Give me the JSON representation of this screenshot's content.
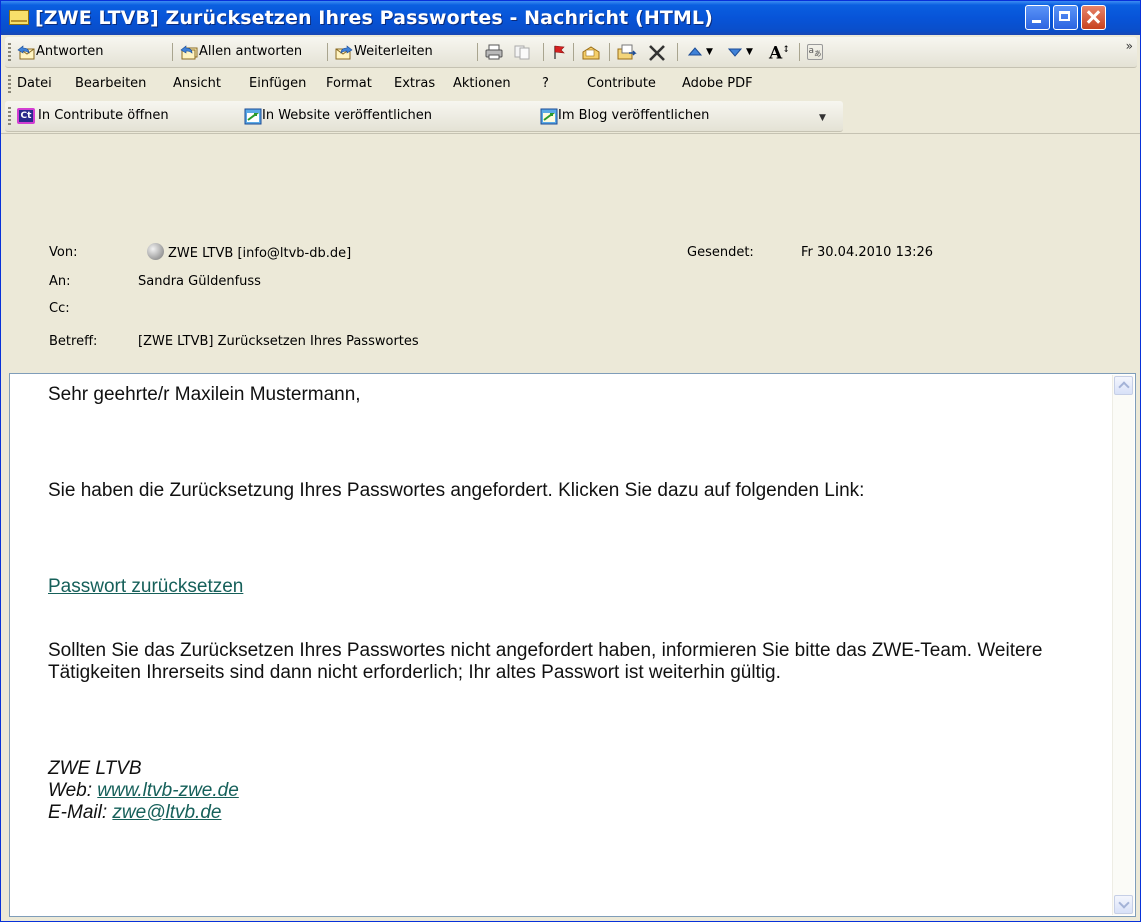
{
  "window": {
    "title": "[ZWE LTVB] Zurücksetzen Ihres Passwortes - Nachricht (HTML)"
  },
  "toolbar": {
    "reply": "Antworten",
    "reply_all": "Allen antworten",
    "forward": "Weiterleiten",
    "overflow": "»"
  },
  "menu": {
    "items": [
      "Datei",
      "Bearbeiten",
      "Ansicht",
      "Einfügen",
      "Format",
      "Extras",
      "Aktionen",
      "?",
      "Contribute",
      "Adobe PDF"
    ]
  },
  "contribute_toolbar": {
    "open_in_contribute": "In Contribute öffnen",
    "publish_website": "In Website veröffentlichen",
    "publish_blog": "Im Blog veröffentlichen",
    "ct_badge": "Ct"
  },
  "header": {
    "from_label": "Von:",
    "from_value": "ZWE LTVB [info@ltvb-db.de]",
    "sent_label": "Gesendet:",
    "sent_value": "Fr 30.04.2010 13:26",
    "to_label": "An:",
    "to_value": "Sandra Güldenfuss",
    "cc_label": "Cc:",
    "cc_value": "",
    "subject_label": "Betreff:",
    "subject_value": "[ZWE LTVB] Zurücksetzen Ihres Passwortes"
  },
  "message": {
    "greeting": "Sehr geehrte/r Maxilein Mustermann,",
    "intro": "Sie haben die Zurücksetzung Ihres Passwortes angefordert. Klicken Sie dazu auf folgenden Link:",
    "reset_link": "Passwort zurücksetzen",
    "notice": "Sollten Sie das Zurücksetzen Ihres Passwortes nicht angefordert haben, informieren Sie bitte das ZWE-Team. Weitere Tätigkeiten Ihrerseits sind dann nicht erforderlich; Ihr altes Passwort ist weiterhin gültig.",
    "signature_name": "ZWE LTVB",
    "web_label": "Web: ",
    "web_link": "www.ltvb-zwe.de",
    "email_label": "E-Mail: ",
    "email_link": "zwe@ltvb.de"
  },
  "colors": {
    "titlebar": "#0754d8",
    "link": "#16605a",
    "chrome": "#ece9d8"
  }
}
